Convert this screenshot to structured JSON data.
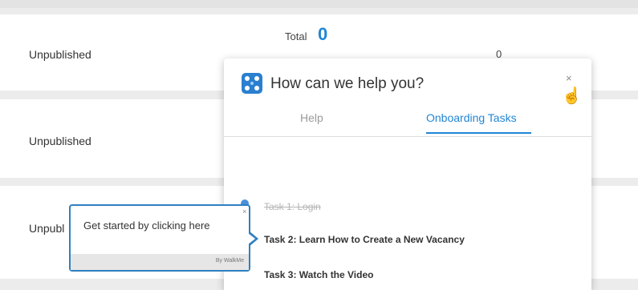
{
  "rows": [
    {
      "status": "Unpublished"
    },
    {
      "status": "Unpublished"
    },
    {
      "status": "Unpubl"
    }
  ],
  "summary": {
    "total_label": "Total",
    "total_value": "0",
    "count_value": "0"
  },
  "help_panel": {
    "title": "How can we help you?",
    "close_glyph": "×",
    "tabs": [
      {
        "label": "Help",
        "active": false
      },
      {
        "label": "Onboarding Tasks",
        "active": true
      }
    ],
    "tasks": [
      {
        "label": "Task 1: Login",
        "completed": true
      },
      {
        "label": "Task 2: Learn How to Create a New Vacancy",
        "completed": false
      },
      {
        "label": "Task 3: Watch the Video",
        "completed": false
      }
    ]
  },
  "tooltip": {
    "text": "Get started by clicking here",
    "close_glyph": "×",
    "brand": "By WalkMe"
  },
  "colors": {
    "accent": "#1f86d6",
    "tooltip_border": "#2f80c0"
  },
  "icons": {
    "logo": "walkme-logo-icon",
    "cursor": "hand-pointer-icon"
  }
}
